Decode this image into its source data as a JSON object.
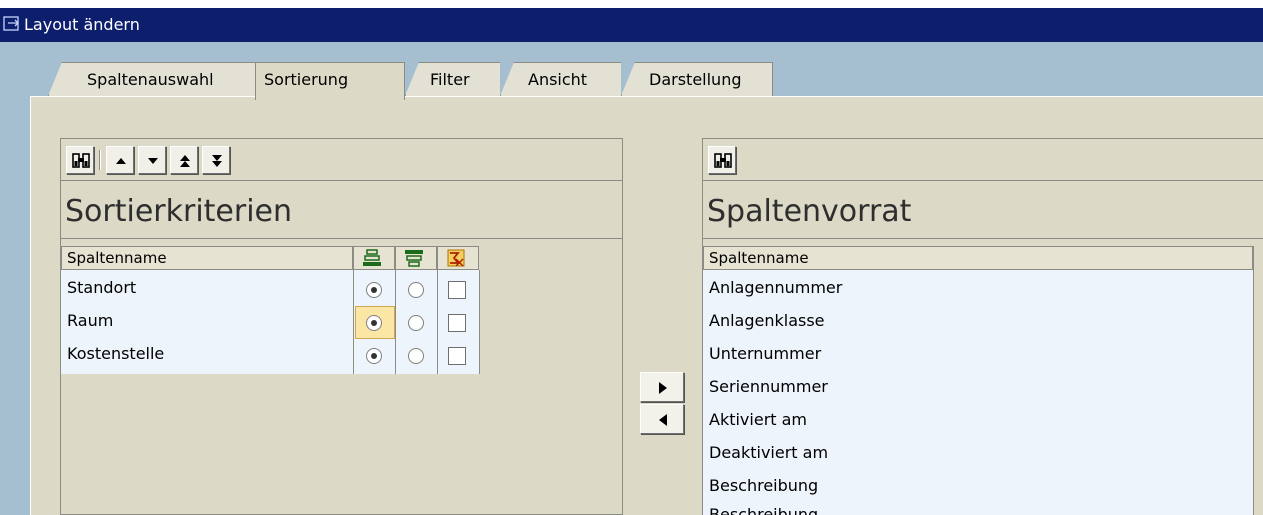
{
  "window": {
    "title": "Layout ändern"
  },
  "tabs": [
    {
      "label": "Spaltenauswahl",
      "active": false
    },
    {
      "label": "Sortierung",
      "active": true
    },
    {
      "label": "Filter",
      "active": false
    },
    {
      "label": "Ansicht",
      "active": false
    },
    {
      "label": "Darstellung",
      "active": false
    }
  ],
  "left_panel": {
    "title": "Sortierkriterien",
    "column_header": "Spaltenname",
    "toolbar_icons": [
      "find-icon",
      "move-up-icon",
      "move-down-icon",
      "move-top-icon",
      "move-bottom-icon"
    ],
    "sort_icons": [
      "sort-ascending-icon",
      "sort-descending-icon",
      "subtotal-icon"
    ],
    "rows": [
      {
        "name": "Standort",
        "ascending": true,
        "descending": false,
        "subtotal": false
      },
      {
        "name": "Raum",
        "ascending": true,
        "descending": false,
        "subtotal": false
      },
      {
        "name": "Kostenstelle",
        "ascending": true,
        "descending": false,
        "subtotal": false
      }
    ]
  },
  "right_panel": {
    "title": "Spaltenvorrat",
    "column_header": "Spaltenname",
    "toolbar_icons": [
      "find-icon"
    ],
    "rows": [
      "Anlagennummer",
      "Anlagenklasse",
      "Unternummer",
      "Seriennummer",
      "Aktiviert am",
      "Deaktiviert am",
      "Beschreibung",
      "Beschreibung"
    ]
  },
  "move_buttons": [
    "move-right-icon",
    "move-left-icon"
  ],
  "colors": {
    "titlebar": "#0c1e6c",
    "window_bg": "#a5bfd0",
    "panel_bg": "#dcd9c6",
    "list_bg": "#eef4fb"
  }
}
